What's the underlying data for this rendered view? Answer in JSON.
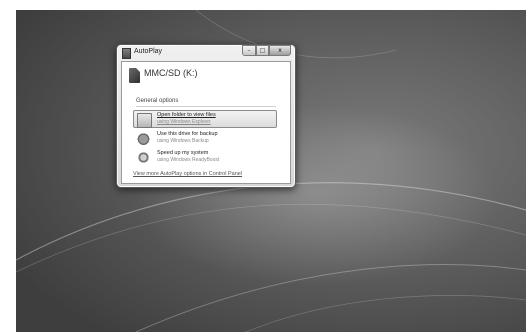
{
  "window": {
    "title": "AutoPlay",
    "minimize_glyph": "–",
    "maximize_glyph": "□",
    "close_glyph": "x"
  },
  "drive": {
    "name": "MMC/SD (K:)",
    "icon": "sd-card-icon"
  },
  "section": {
    "label": "General options"
  },
  "options": [
    {
      "title": "Open folder to view files",
      "subtitle": "using Windows Explorer",
      "icon": "folder-icon",
      "selected": true
    },
    {
      "title": "Use this drive for backup",
      "subtitle": "using Windows Backup",
      "icon": "backup-icon",
      "selected": false
    },
    {
      "title": "Speed up my system",
      "subtitle": "using Windows ReadyBoost",
      "icon": "speed-icon",
      "selected": false
    }
  ],
  "footer": {
    "link": "View more AutoPlay options in Control Panel"
  }
}
